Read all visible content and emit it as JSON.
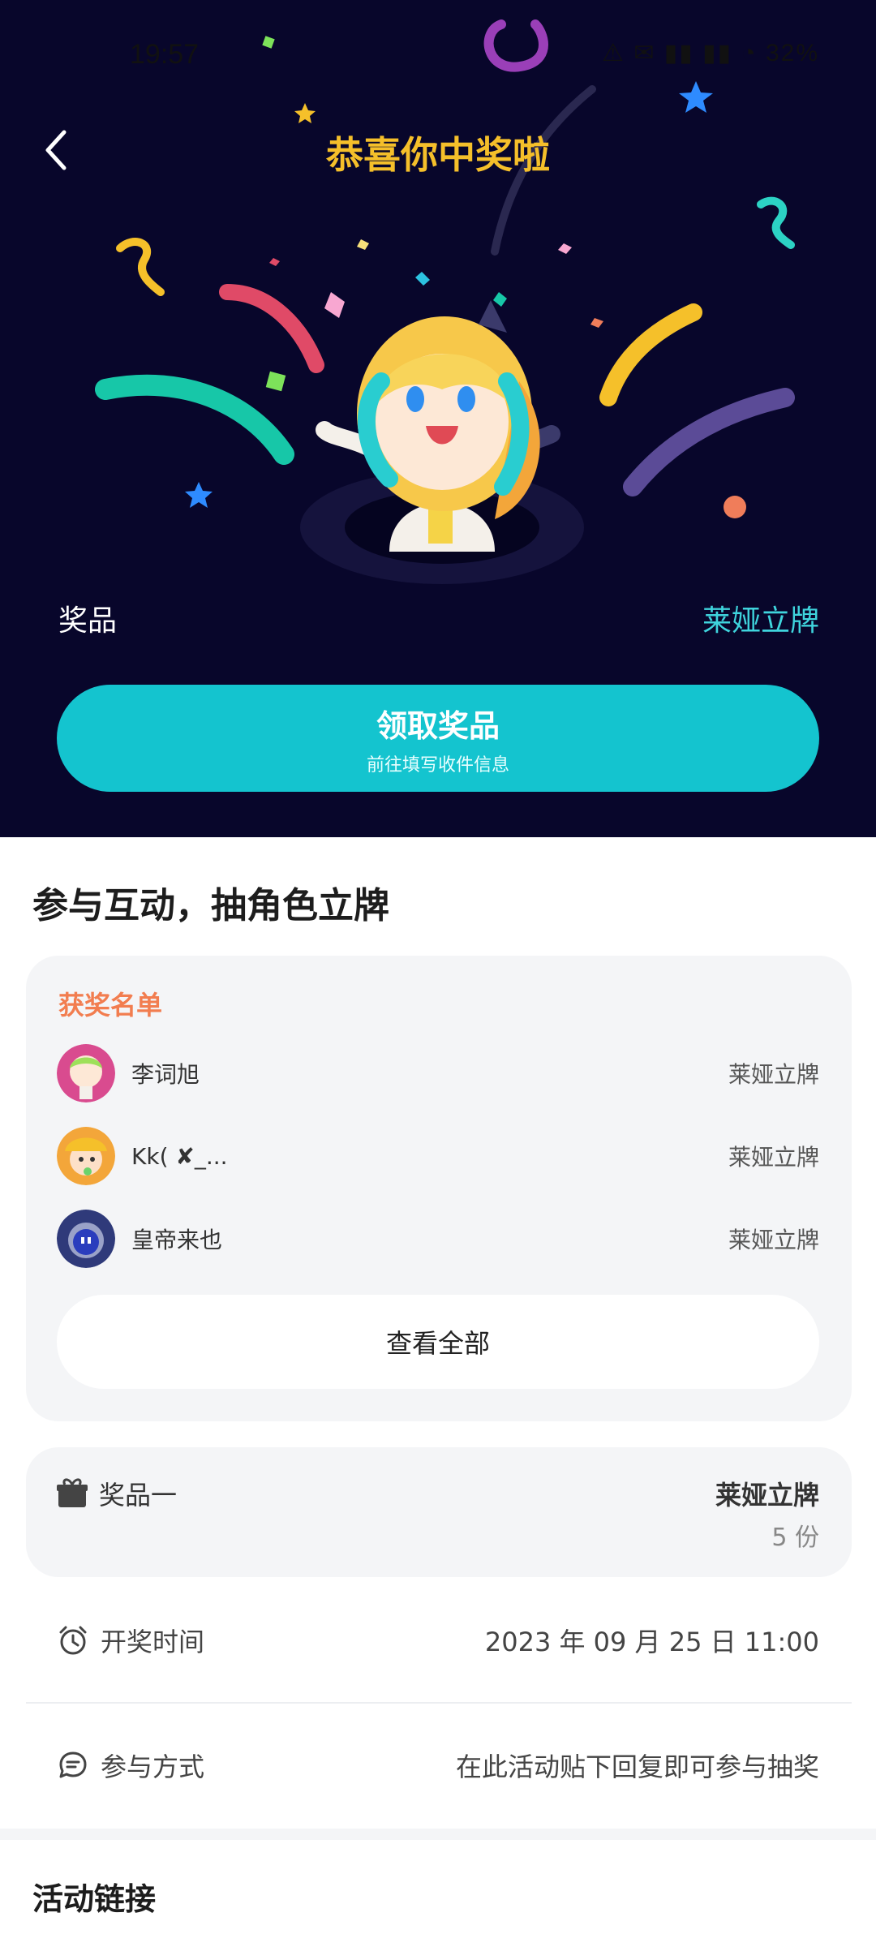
{
  "status_bar": {
    "time": "19:57",
    "icons_text": "⚠ ✉ ▮▮ ▮▮ ◔ 32%"
  },
  "header": {
    "back_icon": "chevron-left-icon",
    "title": "恭喜你中奖啦"
  },
  "prize": {
    "label": "奖品",
    "value": "莱娅立牌"
  },
  "claim_button": {
    "title": "领取奖品",
    "subtitle": "前往填写收件信息"
  },
  "section": {
    "title": "参与互动，抽角色立牌"
  },
  "winners": {
    "heading": "获奖名单",
    "rows": [
      {
        "name": "李词旭",
        "prize": "莱娅立牌"
      },
      {
        "name": "Kk( ✘_...",
        "prize": "莱娅立牌"
      },
      {
        "name": "皇帝来也",
        "prize": "莱娅立牌"
      }
    ],
    "view_all": "查看全部"
  },
  "prize_card": {
    "label": "奖品一",
    "name": "莱娅立牌",
    "count": "5 份"
  },
  "draw_time": {
    "label": "开奖时间",
    "value": "2023 年 09 月 25 日 11:00"
  },
  "participation": {
    "label": "参与方式",
    "value": "在此活动贴下回复即可参与抽奖"
  },
  "links": {
    "title": "活动链接"
  },
  "colors": {
    "hero_bg": "#08062b",
    "accent": "#14c4cf",
    "title_gold": "#f5bf2a",
    "winners_heading": "#f27d4f"
  }
}
